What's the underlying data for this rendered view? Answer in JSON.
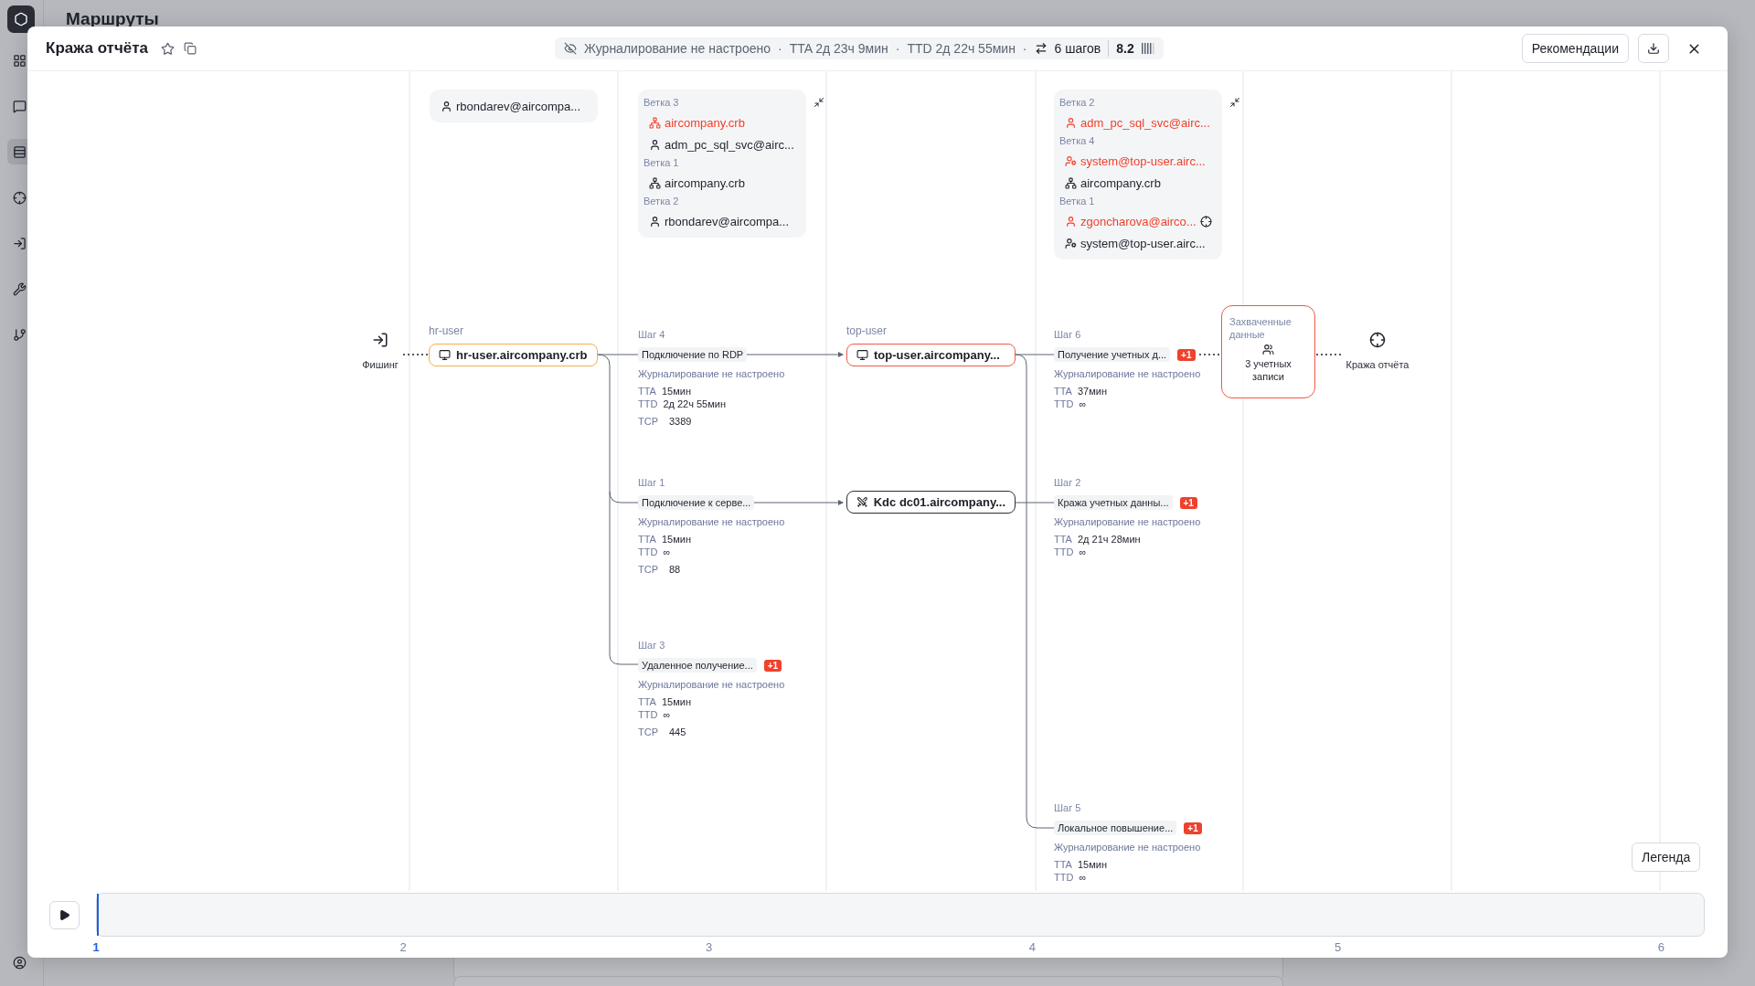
{
  "page": {
    "title": "Маршруты"
  },
  "sidebar": {
    "items": [
      {
        "selected": false
      },
      {
        "selected": false
      },
      {
        "selected": true
      },
      {
        "selected": false
      },
      {
        "selected": false
      },
      {
        "selected": false
      },
      {
        "selected": false
      }
    ]
  },
  "modal": {
    "title": "Кража отчёта",
    "summary": {
      "logging": "Журналирование не настроено",
      "separator": "·",
      "tta": "TTA 2д 23ч 9мин",
      "ttd": "TTD 2д 22ч 55мин",
      "steps": "6 шагов",
      "score": "8.2"
    },
    "recommendations_button": "Рекомендации"
  },
  "diagram": {
    "start": {
      "label": "Фишинг"
    },
    "goal": {
      "label": "Кража отчёта"
    },
    "hosts": [
      {
        "group": "hr-user",
        "name": "hr-user.aircompany.crb",
        "kind": "workstation",
        "color": "#f2b04a"
      },
      {
        "group": "top-user",
        "name": "top-user.aircompany...",
        "kind": "workstation",
        "color": "#f05a45"
      },
      {
        "name": "Kdc dc01.aircompany...",
        "kind": "server",
        "color": "#2a2f3a"
      }
    ],
    "credential_cards": [
      {
        "collapsible": false,
        "branches": [
          {
            "items": [
              {
                "kind": "user",
                "text": "rbondarev@aircompa...",
                "captured": false,
                "target": false
              }
            ]
          }
        ]
      },
      {
        "collapsible": true,
        "branches": [
          {
            "label": "Ветка 3",
            "items": [
              {
                "kind": "domain",
                "text": "aircompany.crb",
                "captured": true,
                "target": false
              },
              {
                "kind": "user",
                "text": "adm_pc_sql_svc@airc...",
                "captured": false,
                "target": false
              }
            ]
          },
          {
            "label": "Ветка 1",
            "items": [
              {
                "kind": "domain",
                "text": "aircompany.crb",
                "captured": false,
                "target": false
              }
            ]
          },
          {
            "label": "Ветка 2",
            "items": [
              {
                "kind": "user",
                "text": "rbondarev@aircompa...",
                "captured": false,
                "target": false
              }
            ]
          }
        ]
      },
      {
        "collapsible": true,
        "branches": [
          {
            "label": "Ветка 2",
            "items": [
              {
                "kind": "user",
                "text": "adm_pc_sql_svc@airc...",
                "captured": true,
                "target": false
              }
            ]
          },
          {
            "label": "Ветка 4",
            "items": [
              {
                "kind": "system",
                "text": "system@top-user.airc...",
                "captured": true,
                "target": false
              },
              {
                "kind": "domain",
                "text": "aircompany.crb",
                "captured": false,
                "target": false
              }
            ]
          },
          {
            "label": "Ветка 1",
            "items": [
              {
                "kind": "user",
                "text": "zgoncharova@airco...",
                "captured": true,
                "target": true
              },
              {
                "kind": "system",
                "text": "system@top-user.airc...",
                "captured": false,
                "target": false
              }
            ]
          }
        ]
      }
    ],
    "steps": [
      {
        "label": "Шаг 4",
        "action": "Подключение по RDP",
        "logging": "Журналирование не настроено",
        "metrics": [
          {
            "kind": "time",
            "key": "TTA",
            "value": "15мин"
          },
          {
            "kind": "time",
            "key": "TTD",
            "value": "2д 22ч 55мин"
          },
          {
            "kind": "port",
            "key": "TCP",
            "value": "3389"
          }
        ]
      },
      {
        "label": "Шаг 1",
        "action": "Подключение к серве...",
        "logging": "Журналирование не настроено",
        "metrics": [
          {
            "kind": "time",
            "key": "TTA",
            "value": "15мин"
          },
          {
            "kind": "time",
            "key": "TTD",
            "value": "∞"
          },
          {
            "kind": "port",
            "key": "TCP",
            "value": "88"
          }
        ]
      },
      {
        "label": "Шаг 3",
        "action": "Удаленное получение...",
        "badge": "+1",
        "logging": "Журналирование не настроено",
        "metrics": [
          {
            "kind": "time",
            "key": "TTA",
            "value": "15мин"
          },
          {
            "kind": "time",
            "key": "TTD",
            "value": "∞"
          },
          {
            "kind": "port",
            "key": "TCP",
            "value": "445"
          }
        ]
      },
      {
        "label": "Шаг 6",
        "action": "Получение учетных д...",
        "badge": "+1",
        "logging": "Журналирование не настроено",
        "metrics": [
          {
            "kind": "time",
            "key": "TTA",
            "value": "37мин"
          },
          {
            "kind": "time",
            "key": "TTD",
            "value": "∞"
          }
        ]
      },
      {
        "label": "Шаг 2",
        "action": "Кража учетных данны...",
        "badge": "+1",
        "logging": "Журналирование не настроено",
        "metrics": [
          {
            "kind": "time",
            "key": "TTA",
            "value": "2д 21ч 28мин"
          },
          {
            "kind": "time",
            "key": "TTD",
            "value": "∞"
          }
        ]
      },
      {
        "label": "Шаг 5",
        "action": "Локальное повышение...",
        "badge": "+1",
        "logging": "Журналирование не настроено",
        "metrics": [
          {
            "kind": "time",
            "key": "TTA",
            "value": "15мин"
          },
          {
            "kind": "time",
            "key": "TTD",
            "value": "∞"
          }
        ]
      }
    ],
    "captured": {
      "title": "Захваченные данные",
      "text": "3 учетных записи"
    },
    "legend_button": "Легенда"
  },
  "timeline": {
    "level": 0,
    "ticks": [
      {
        "label": "1",
        "selected": true
      },
      {
        "label": "2",
        "selected": false
      },
      {
        "label": "3",
        "selected": false
      },
      {
        "label": "4",
        "selected": false
      },
      {
        "label": "5",
        "selected": false
      },
      {
        "label": "6",
        "selected": false
      }
    ]
  }
}
